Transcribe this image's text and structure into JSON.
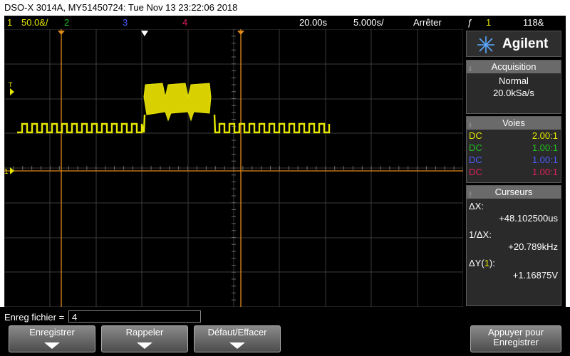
{
  "window": {
    "title": "DSO-X 3014A, MY51450724: Tue Nov 13 23:22:06 2018"
  },
  "topbar": {
    "ch1_num": "1",
    "ch1_scale": "50.0&/",
    "ch2_num": "2",
    "ch3_num": "3",
    "ch4_num": "4",
    "time_scale": "20.00s",
    "time_delay": "5.000s/",
    "run_state": "Arrêter",
    "trigger_symbol": "ƒ",
    "trigger_source": "1",
    "trigger_level": "118&"
  },
  "scope": {
    "trigger_marker": "T",
    "ground_marker": "1"
  },
  "brand": {
    "name": "Agilent"
  },
  "acquisition": {
    "header": "Acquisition",
    "mode": "Normal",
    "rate": "20.0kSa/s"
  },
  "channels": {
    "header": "Voies",
    "rows": [
      {
        "coupling": "DC",
        "probe": "2.00:1",
        "color": "#e6e600"
      },
      {
        "coupling": "DC",
        "probe": "1.00:1",
        "color": "#22c022"
      },
      {
        "coupling": "DC",
        "probe": "1.00:1",
        "color": "#4a5cff"
      },
      {
        "coupling": "DC",
        "probe": "1.00:1",
        "color": "#e0205a"
      }
    ]
  },
  "cursors": {
    "header": "Curseurs",
    "dx_label": "ΔX:",
    "dx_value": "+48.102500us",
    "inv_label": "1/ΔX:",
    "inv_value": "+20.789kHz",
    "dy_label_prefix": "ΔY(",
    "dy_label_ch": "1",
    "dy_label_suffix": "):",
    "dy_value": "+1.16875V"
  },
  "bottom": {
    "file_label": "Enreg fichier =",
    "file_value": "4",
    "softkeys": [
      "Enregistrer",
      "Rappeler",
      "Défaut/Effacer"
    ],
    "press_label_line1": "Appuyer pour",
    "press_label_line2": "Enregistrer"
  },
  "colors": {
    "ch1": "#e6e600",
    "ch2": "#22c022",
    "ch3": "#4a5cff",
    "ch4": "#e0205a",
    "cursor": "#e08a1a"
  }
}
